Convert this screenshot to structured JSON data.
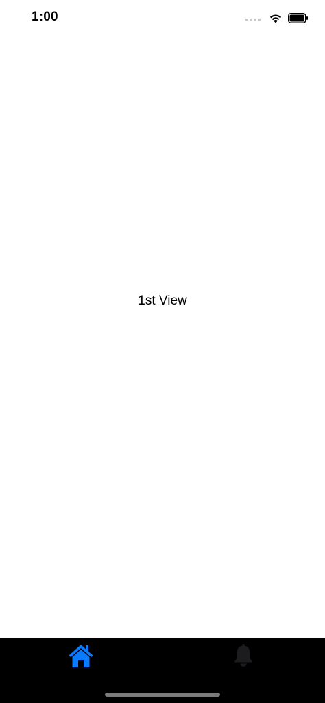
{
  "status_bar": {
    "time": "1:00",
    "icons": [
      "cellular-signal-icon",
      "wifi-icon",
      "battery-icon"
    ]
  },
  "main": {
    "view_label": "1st View"
  },
  "tab_bar": {
    "background": "#000000",
    "tabs": [
      {
        "icon": "home-icon",
        "selected": true,
        "color": "#0a7aff"
      },
      {
        "icon": "bell-icon",
        "selected": false,
        "color": "#1c1c1e"
      }
    ]
  },
  "colors": {
    "accent": "#0a7aff",
    "background": "#ffffff",
    "tab_bar": "#000000"
  }
}
